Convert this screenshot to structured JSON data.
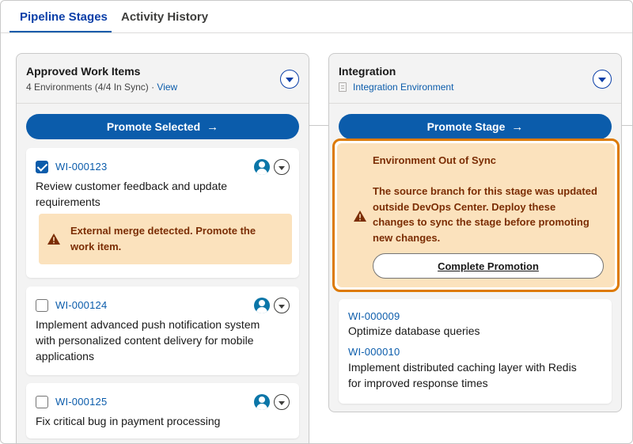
{
  "tabs": [
    {
      "label": "Pipeline Stages",
      "active": true
    },
    {
      "label": "Activity History",
      "active": false
    }
  ],
  "approved": {
    "title": "Approved Work Items",
    "subtitle": "4 Environments (4/4 In Sync) · ",
    "view_link": "View",
    "promote_label": "Promote Selected",
    "items": [
      {
        "id": "WI-000123",
        "checked": true,
        "description": [
          "Review customer feedback and update",
          "requirements"
        ],
        "warning": [
          "External merge detected. Promote the",
          "work item."
        ]
      },
      {
        "id": "WI-000124",
        "checked": false,
        "description": [
          "Implement advanced push notification system",
          "with personalized content delivery for mobile",
          "applications"
        ]
      },
      {
        "id": "WI-000125",
        "checked": false,
        "description": [
          "Fix critical bug in payment processing"
        ]
      }
    ]
  },
  "integration": {
    "title": "Integration",
    "env_link": "Integration Environment",
    "promote_label": "Promote Stage",
    "alert": {
      "title": "Environment Out of Sync",
      "body": [
        "The source branch for this stage was updated",
        "outside DevOps Center. Deploy these",
        "changes to sync the stage before promoting",
        "new changes."
      ],
      "button": "Complete Promotion"
    },
    "items": [
      {
        "id": "WI-000009",
        "description": [
          "Optimize database queries"
        ]
      },
      {
        "id": "WI-000010",
        "description": [
          "Implement distributed caching layer with Redis",
          "for improved response times"
        ]
      }
    ]
  },
  "colors": {
    "brand": "#0b5cab",
    "warning_bg": "#fbe2bd",
    "warning_text": "#7b2d04",
    "highlight_border": "#dd7a01"
  },
  "icons": {
    "arrow": "→",
    "warning": "warning-triangle-icon",
    "avatar": "user-avatar-icon",
    "dropdown": "chevron-down-icon"
  }
}
